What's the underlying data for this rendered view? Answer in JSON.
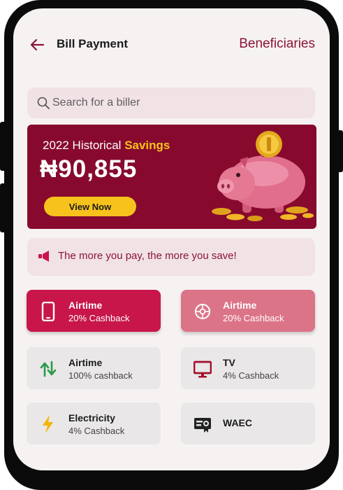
{
  "header": {
    "title": "Bill Payment",
    "beneficiaries_link": "Beneficiaries"
  },
  "search": {
    "placeholder": "Search for a biller"
  },
  "banner": {
    "label": "2022 Historical",
    "label_highlight": "Savings",
    "amount": "₦90,855",
    "button_label": "View Now"
  },
  "promo": {
    "text": "The more you pay, the more you save!"
  },
  "billers": [
    {
      "title": "Airtime",
      "subtitle": "20% Cashback",
      "icon": "phone-icon"
    },
    {
      "title": "Airtime",
      "subtitle": "20% Cashback",
      "icon": "globe-icon"
    },
    {
      "title": "Airtime",
      "subtitle": "100% cashback",
      "icon": "data-transfer-icon"
    },
    {
      "title": "TV",
      "subtitle": "4% Cashback",
      "icon": "tv-icon"
    },
    {
      "title": "Electricity",
      "subtitle": "4% Cashback",
      "icon": "lightning-icon"
    },
    {
      "title": "WAEC",
      "subtitle": "",
      "icon": "certificate-icon"
    }
  ],
  "colors": {
    "brand": "#870a2e",
    "accent": "#f8c21c",
    "primary_tile": "#c8154a",
    "secondary_tile": "#dc7488"
  }
}
